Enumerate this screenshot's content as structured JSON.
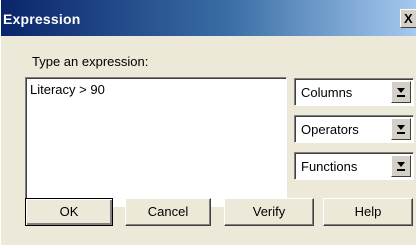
{
  "window": {
    "title": "Expression",
    "close_glyph": "X"
  },
  "prompt_label": "Type an expression:",
  "expression": {
    "value": "Literacy > 90"
  },
  "dropdowns": [
    {
      "label": "Columns",
      "icon": "dropdown-arrow-icon"
    },
    {
      "label": "Operators",
      "icon": "dropdown-arrow-icon"
    },
    {
      "label": "Functions",
      "icon": "dropdown-arrow-icon"
    }
  ],
  "buttons": {
    "ok": "OK",
    "cancel": "Cancel",
    "verify": "Verify",
    "help": "Help"
  }
}
